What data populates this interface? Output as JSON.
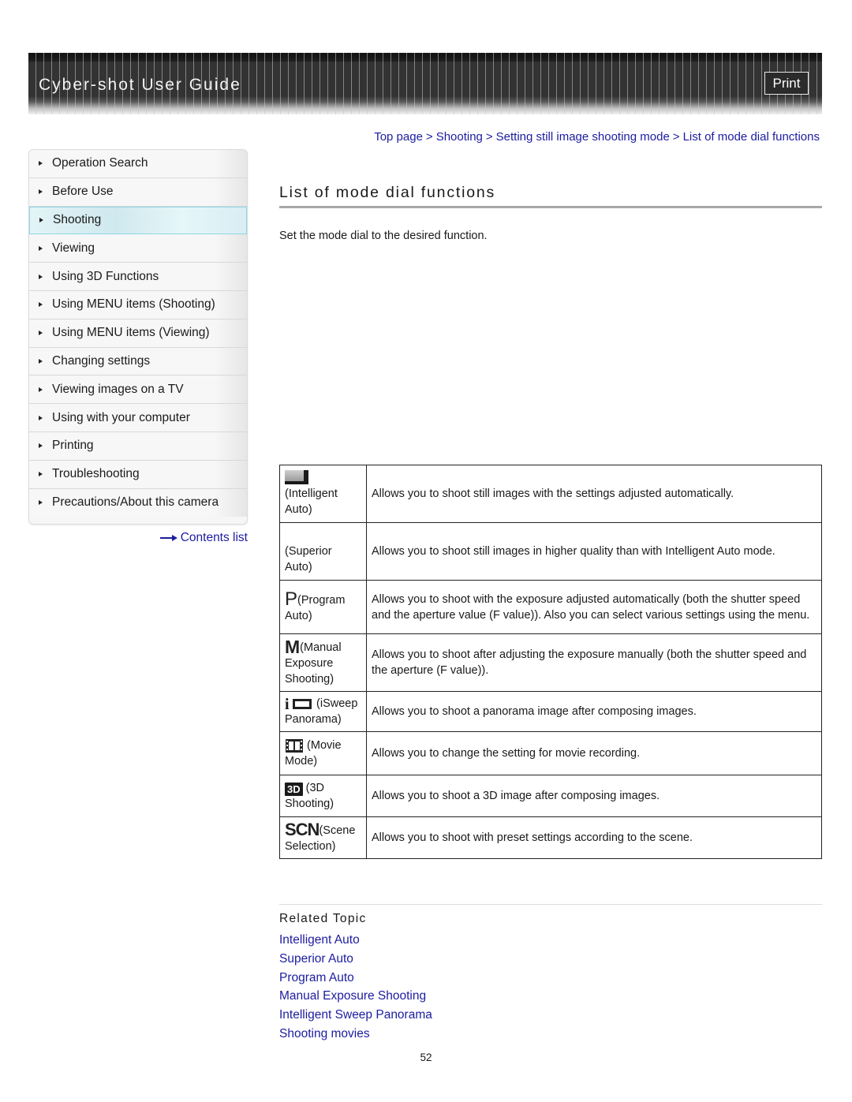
{
  "header": {
    "title": "Cyber-shot User Guide",
    "print_label": "Print"
  },
  "breadcrumb": [
    {
      "label": "Top page"
    },
    {
      "label": "Shooting"
    },
    {
      "label": "Setting still image shooting mode"
    },
    {
      "label": "List of mode dial functions"
    }
  ],
  "breadcrumb_separator": ">",
  "sidebar": {
    "items": [
      {
        "label": "Operation Search",
        "active": false
      },
      {
        "label": "Before Use",
        "active": false
      },
      {
        "label": "Shooting",
        "active": true
      },
      {
        "label": "Viewing",
        "active": false
      },
      {
        "label": "Using 3D Functions",
        "active": false
      },
      {
        "label": "Using MENU items (Shooting)",
        "active": false
      },
      {
        "label": "Using MENU items (Viewing)",
        "active": false
      },
      {
        "label": "Changing settings",
        "active": false
      },
      {
        "label": "Viewing images on a TV",
        "active": false
      },
      {
        "label": "Using with your computer",
        "active": false
      },
      {
        "label": "Printing",
        "active": false
      },
      {
        "label": "Troubleshooting",
        "active": false
      },
      {
        "label": "Precautions/About this camera",
        "active": false
      }
    ],
    "contents_link": "Contents list"
  },
  "main": {
    "title": "List of mode dial functions",
    "intro": "Set the mode dial to the desired function.",
    "modes": [
      {
        "icon": "intelligent-auto-icon",
        "glyph": "",
        "name": "(Intelligent Auto)",
        "description": "Allows you to shoot still images with the settings adjusted automatically."
      },
      {
        "icon": "superior-auto-icon",
        "glyph": "",
        "name": "(Superior Auto)",
        "description": "Allows you to shoot still images in higher quality than with Intelligent Auto mode."
      },
      {
        "icon": "program-auto-icon",
        "glyph": "P",
        "name": "(Program Auto)",
        "description": "Allows you to shoot with the exposure adjusted automatically (both the shutter speed and the aperture value (F value)). Also you can select various settings using the menu."
      },
      {
        "icon": "manual-exposure-icon",
        "glyph": "M",
        "name": "(Manual Exposure Shooting)",
        "description": "Allows you to shoot after adjusting the exposure manually (both the shutter speed and the aperture (F value))."
      },
      {
        "icon": "isweep-panorama-icon",
        "glyph": "i",
        "name": "(iSweep Panorama)",
        "description": "Allows you to shoot a panorama image after composing images."
      },
      {
        "icon": "movie-mode-icon",
        "glyph": "",
        "name": "(Movie Mode)",
        "description": "Allows you to change the setting for movie recording."
      },
      {
        "icon": "3d-shooting-icon",
        "glyph": "3D",
        "name": "(3D Shooting)",
        "description": "Allows you to shoot a 3D image after composing images."
      },
      {
        "icon": "scene-selection-icon",
        "glyph": "SCN",
        "name": "(Scene Selection)",
        "description": "Allows you to shoot with preset settings according to the scene."
      }
    ]
  },
  "related": {
    "title": "Related Topic",
    "links": [
      "Intelligent Auto",
      "Superior Auto",
      "Program Auto",
      "Manual Exposure Shooting",
      "Intelligent Sweep Panorama",
      "Shooting movies"
    ]
  },
  "page_number": "52"
}
